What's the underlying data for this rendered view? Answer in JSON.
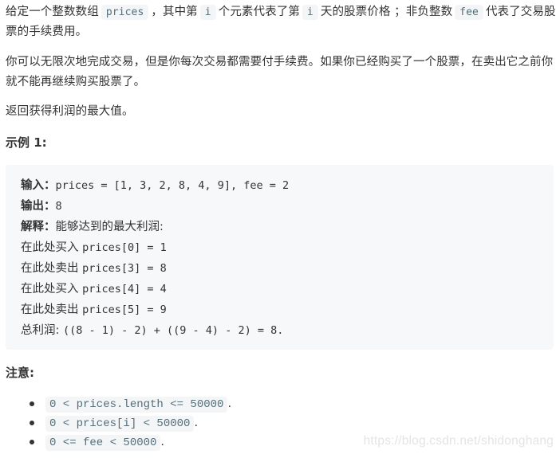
{
  "description": {
    "p1": {
      "t1": "给定一个整数数组",
      "c1": "prices",
      "t2": "，其中第",
      "c2": "i",
      "t3": "个元素代表了第",
      "c3": "i",
      "t4": "天的股票价格 ；非负整数",
      "c4": "fee",
      "t5": "代表了交易股票的手续费用。"
    },
    "p2": "你可以无限次地完成交易，但是你每次交易都需要付手续费。如果你已经购买了一个股票，在卖出它之前你就不能再继续购买股票了。",
    "p3": "返回获得利润的最大值。"
  },
  "example": {
    "title": "示例 1:",
    "input_label": "输入：",
    "input_value": "prices = [1, 3, 2, 8, 4, 9], fee = 2",
    "output_label": "输出：",
    "output_value": "8",
    "explain_label": "解释：",
    "explain_text": "能够达到的最大利润:",
    "steps": [
      {
        "action": "在此处买入 ",
        "expr": "prices[0] = 1"
      },
      {
        "action": "在此处卖出 ",
        "expr": "prices[3] = 8"
      },
      {
        "action": "在此处买入 ",
        "expr": "prices[4] = 4"
      },
      {
        "action": "在此处卖出 ",
        "expr": "prices[5] = 9"
      }
    ],
    "total_label": "总利润: ",
    "total_expr": "((8 - 1) - 2) + ((9 - 4) - 2) = 8."
  },
  "notes": {
    "title": "注意:",
    "items": [
      {
        "code": "0 < prices.length <= 50000",
        "suffix": "."
      },
      {
        "code": "0 < prices[i] < 50000",
        "suffix": "."
      },
      {
        "code": "0 <= fee < 50000",
        "suffix": "."
      }
    ]
  },
  "watermark": "https://blog.csdn.net/shidonghang"
}
